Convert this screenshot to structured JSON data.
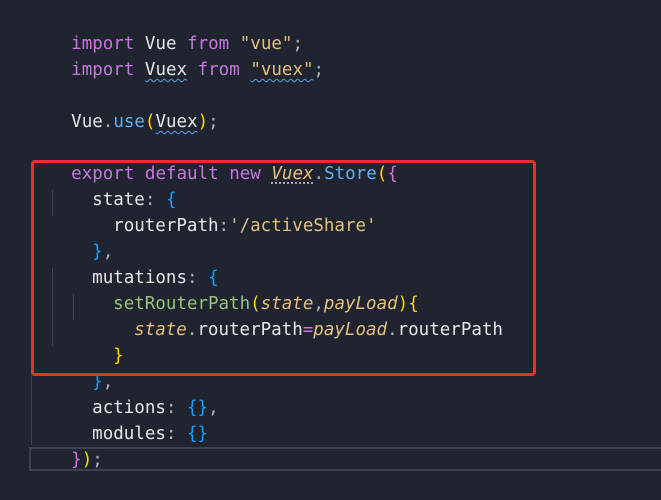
{
  "code": {
    "l1": {
      "kw1": "import",
      "id": " Vue ",
      "kw2": "from",
      "str": " \"vue\"",
      "end": ";"
    },
    "l2": {
      "kw1": "import",
      "sp": " ",
      "id": "Vuex",
      "kw2": " from",
      "sp2": " ",
      "str": "\"vuex\"",
      "end": ";"
    },
    "l4": {
      "obj": "Vue",
      "dot": ".",
      "fn": "use",
      "open": "(",
      "arg": "Vuex",
      "close": ")",
      "end": ";"
    },
    "l6": {
      "kw1": "export",
      "kw2": " default",
      "kw3": " new",
      "sp": " ",
      "cls": "Vuex",
      "dot": ".",
      "fn": "Store",
      "open": "(",
      "brace": "{"
    },
    "l7": {
      "prop": "state",
      "colon": ":",
      "sp": " ",
      "brace": "{"
    },
    "l8": {
      "prop": "routerPath",
      "colon": ":",
      "str": "'/activeShare'"
    },
    "l9": {
      "brace": "}",
      "comma": ","
    },
    "l10": {
      "prop": "mutations",
      "colon": ":",
      "sp": " ",
      "brace": "{"
    },
    "l11": {
      "fn": "setRouterPath",
      "open": "(",
      "p1": "state",
      "comma": ",",
      "p2": "payLoad",
      "close": ")",
      "brace": "{"
    },
    "l12": {
      "obj": "state",
      "dot": ".",
      "prop": "routerPath",
      "eq": "=",
      "obj2": "payLoad",
      "dot2": ".",
      "prop2": "routerPath"
    },
    "l13": {
      "brace": "}"
    },
    "l14": {
      "brace": "}",
      "comma": ","
    },
    "l15": {
      "prop": "actions",
      "colon": ":",
      "sp": " ",
      "braces": "{}",
      "comma": ","
    },
    "l16": {
      "prop": "modules",
      "colon": ":",
      "sp": " ",
      "braces": "{}"
    },
    "l17": {
      "brace": "}",
      "paren": ")",
      "end": ";"
    }
  },
  "colors": {
    "background": "#1f2430",
    "highlight_border": "#e8312f",
    "keyword": "#c678dd",
    "string": "#e5c07b",
    "function": "#61afef"
  }
}
